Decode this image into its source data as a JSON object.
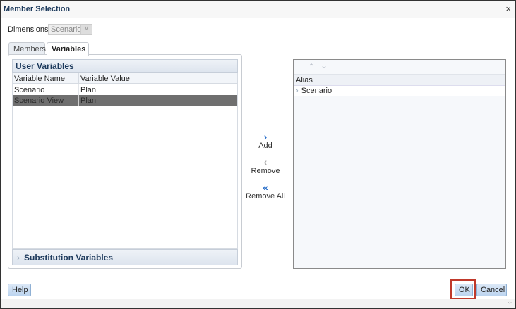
{
  "dialog": {
    "title": "Member Selection",
    "close_icon": "×"
  },
  "dimensions": {
    "label": "Dimensions",
    "value": "Scenario"
  },
  "tabs": [
    {
      "label": "Members",
      "active": false
    },
    {
      "label": "Variables",
      "active": true
    }
  ],
  "user_variables": {
    "title": "User Variables",
    "columns": [
      "Variable Name",
      "Variable Value"
    ],
    "rows": [
      {
        "name": "Scenario",
        "value": "Plan",
        "selected": false
      },
      {
        "name": "Scenario View",
        "value": "Plan",
        "selected": true
      }
    ]
  },
  "substitution_variables": {
    "title": "Substitution Variables"
  },
  "move_buttons": {
    "add": "Add",
    "remove": "Remove",
    "remove_all": "Remove All"
  },
  "selection": {
    "column": "Alias",
    "items": [
      "Scenario"
    ]
  },
  "footer": {
    "help": "Help",
    "ok": "OK",
    "cancel": "Cancel"
  },
  "colors": {
    "highlight": "#c0392b",
    "selected_row": "#6f6f6f"
  }
}
